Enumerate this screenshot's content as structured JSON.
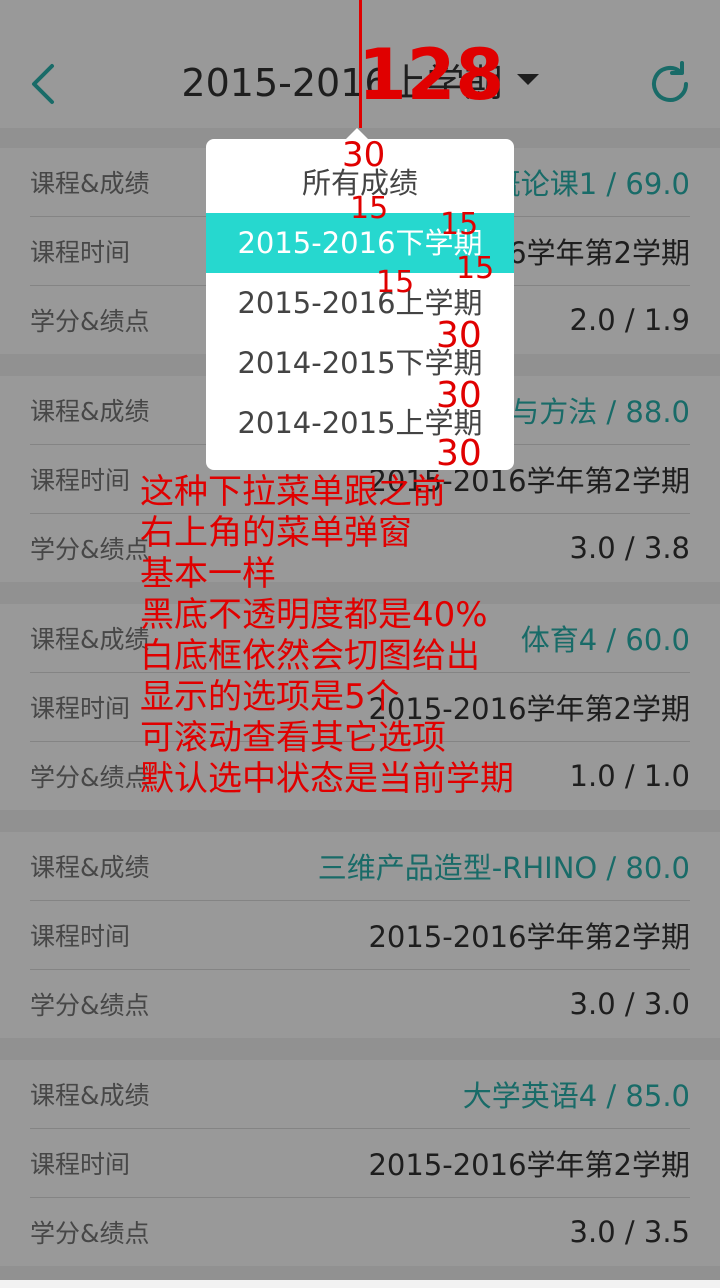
{
  "header": {
    "title": "2015-2016上学期",
    "back_icon": "back-arrow-icon",
    "refresh_icon": "refresh-icon",
    "accent": "#2ab3ad"
  },
  "labels": {
    "course_score": "课程&成绩",
    "course_time": "课程时间",
    "credit_gpa": "学分&绩点"
  },
  "courses": [
    {
      "name_score": "概论课1 / 69.0",
      "time": "2015-2016学年第2学期",
      "credit_gpa": "2.0 / 1.9"
    },
    {
      "name_score": "与方法 / 88.0",
      "time": "2015-2016学年第2学期",
      "credit_gpa": "3.0 / 3.8"
    },
    {
      "name_score": "体育4 / 60.0",
      "time": "2015-2016学年第2学期",
      "credit_gpa": "1.0 / 1.0"
    },
    {
      "name_score": "三维产品造型-RHINO / 80.0",
      "time": "2015-2016学年第2学期",
      "credit_gpa": "3.0 / 3.0"
    },
    {
      "name_score": "大学英语4 / 85.0",
      "time": "2015-2016学年第2学期",
      "credit_gpa": "3.0 / 3.5"
    }
  ],
  "dropdown": {
    "items": [
      "所有成绩",
      "2015-2016下学期",
      "2015-2016上学期",
      "2014-2015下学期",
      "2014-2015上学期"
    ],
    "selected_index": 1,
    "selected_color": "#26d8cf",
    "overlay_opacity": 0.4
  },
  "annotations": {
    "top": "128",
    "small": [
      "30",
      "15",
      "15",
      "15",
      "15"
    ],
    "mid": [
      "30",
      "30",
      "30"
    ],
    "note": [
      "这种下拉菜单跟之前",
      "右上角的菜单弹窗",
      "基本一样",
      "黑底不透明度都是40%",
      "白底框依然会切图给出",
      "显示的选项是5个",
      "可滚动查看其它选项",
      "默认选中状态是当前学期"
    ]
  }
}
